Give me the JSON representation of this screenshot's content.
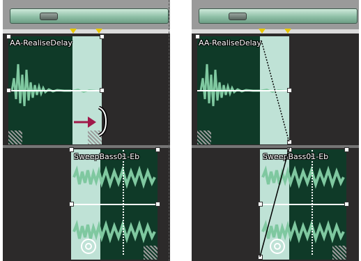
{
  "panels": {
    "left": {
      "clip_a_name": "AA-RealiseDelay",
      "clip_b_name": "SweepBass01-Eb"
    },
    "right": {
      "clip_a_name": "AA-RealiseDelay",
      "clip_b_name": "SweepBass01-Eb"
    }
  },
  "icons": {
    "pointer": "arrow-right-icon",
    "cursor": "trim-bracket-cursor-icon",
    "loop": "loop-icon",
    "marker": "marker-triangle-icon"
  },
  "colors": {
    "track_bg": "#2c2a2a",
    "clip_dark": "#0f3a28",
    "clip_light": "#bfe2d6",
    "arrow": "#a01a4a",
    "marker": "#e8c800"
  }
}
